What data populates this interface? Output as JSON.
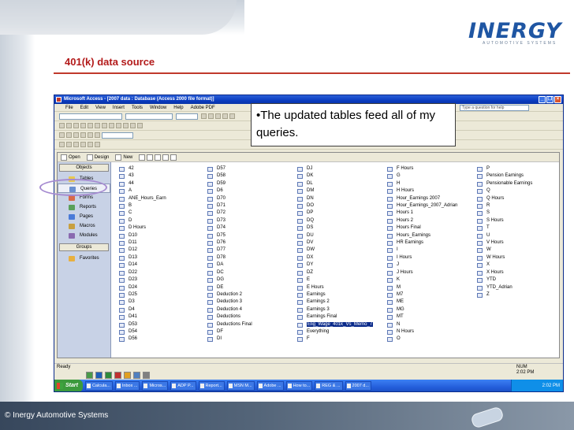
{
  "slide": {
    "title": "401(k) data source",
    "logo": "INERGY",
    "logo_tagline": "AUTOMOTIVE SYSTEMS",
    "footer": "© Inergy Automotive Systems"
  },
  "window": {
    "title": "Microsoft Access - [2007 data : Database (Access 2000 file format)]",
    "menu": [
      "File",
      "Edit",
      "View",
      "Insert",
      "Tools",
      "Window",
      "Help",
      "Adobe PDF"
    ],
    "help_placeholder": "Type a question for help"
  },
  "callout": {
    "text": "•The updated tables feed all of my queries."
  },
  "db_toolbar": {
    "open": "Open",
    "design": "Design",
    "new": "New"
  },
  "objects_pane": {
    "header": "Objects",
    "items": [
      {
        "label": "Tables",
        "icon": "table-icon",
        "color": "#e8c850"
      },
      {
        "label": "Queries",
        "icon": "query-icon",
        "color": "#6a8fd0"
      },
      {
        "label": "Forms",
        "icon": "form-icon",
        "color": "#d86a4a"
      },
      {
        "label": "Reports",
        "icon": "report-icon",
        "color": "#5aa05a"
      },
      {
        "label": "Pages",
        "icon": "page-icon",
        "color": "#4a7ad8"
      },
      {
        "label": "Macros",
        "icon": "macro-icon",
        "color": "#c8a040"
      },
      {
        "label": "Modules",
        "icon": "module-icon",
        "color": "#8a6ab0"
      }
    ],
    "groups_header": "Groups",
    "favorites": "Favorites"
  },
  "queries": [
    [
      "42",
      "43",
      "44",
      "A",
      "ANE_Hours_Earn",
      "B",
      "C",
      "D",
      "D Hours",
      "D10",
      "D11",
      "D12",
      "D13",
      "D14",
      "D22",
      "D23",
      "D24",
      "D25",
      "D3",
      "D4",
      "D41",
      "D53",
      "D54",
      "D56"
    ],
    [
      "D57",
      "D58",
      "D59",
      "D6",
      "D70",
      "D71",
      "D72",
      "D73",
      "D74",
      "D75",
      "D76",
      "D77",
      "D78",
      "DA",
      "DC",
      "DG",
      "DE",
      "Deduction 2",
      "Deduction 3",
      "Deduction 4",
      "Deductions",
      "Deductions Final",
      "DF",
      "DI"
    ],
    [
      "DJ",
      "DK",
      "DL",
      "DM",
      "DN",
      "DO",
      "DP",
      "DQ",
      "DS",
      "DU",
      "DV",
      "DW",
      "DX",
      "DY",
      "DZ",
      "E",
      "E Hours",
      "Earnings",
      "Earnings 2",
      "Earnings 3",
      "Earnings Final",
      "Elig_Wage_401k_Vs_Memo_7",
      "Everything",
      "F"
    ],
    [
      "F Hours",
      "G",
      "H",
      "H Hours",
      "Hour_Earnings 2007",
      "Hour_Earnings_2007_Adrian",
      "Hours 1",
      "Hours 2",
      "Hours Final",
      "Hours_Earnings",
      "HR Earnings",
      "I",
      "I Hours",
      "J",
      "J Hours",
      "K",
      "M",
      "M7",
      "ME",
      "MG",
      "MT",
      "N",
      "N Hours",
      "O"
    ],
    [
      "P",
      "Pension Earnings",
      "Pensionable Earnings",
      "Q",
      "Q Hours",
      "R",
      "S",
      "S Hours",
      "T",
      "U",
      "V Hours",
      "W",
      "W Hours",
      "X",
      "X Hours",
      "YTD",
      "YTD_Adrian",
      "Z"
    ]
  ],
  "selected_query": "Elig_Wage_401k_Vs_Memo_7",
  "status": {
    "ready": "Ready",
    "num": "NUM",
    "clock": "2:02 PM"
  },
  "taskbar": {
    "start": "Start",
    "tasks": [
      "Calcula...",
      "Inbox ...",
      "Micros...",
      "ADP P...",
      "Report...",
      "MSN M...",
      "Adobe ...",
      "How to...",
      "REG & ...",
      "2007 d..."
    ],
    "tray_clock": "2:02 PM"
  },
  "colors": {
    "accent_red": "#b31a1a",
    "selection": "#0a2a8a",
    "titlebar": "#0a3cc0"
  }
}
